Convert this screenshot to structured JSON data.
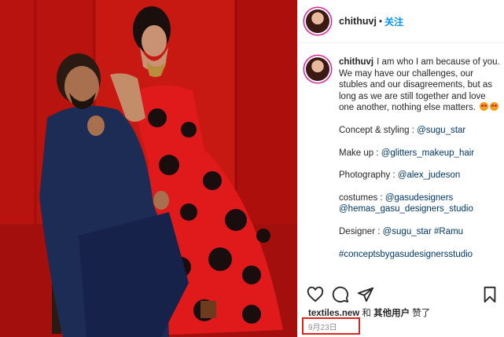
{
  "photo": {
    "alt_subject": "couple-photo",
    "accent_red": "#d41b16",
    "dress_red": "#e0191b",
    "suit_navy": "#1d2c55"
  },
  "header": {
    "username": "chithuvj",
    "separator": "•",
    "follow_label": "关注"
  },
  "caption": {
    "username": "chithuvj",
    "text": "I am who I am because of you. We may have our challenges, our stubles and our disagreements, but as long as we are still together and love one another, nothing else matters.",
    "concept_label": "Concept & styling : ",
    "concept_link": "@sugu_star",
    "makeup_label": "Make up : ",
    "makeup_link": "@glitters_makeup_hair",
    "photography_label": "Photography : ",
    "photography_link": "@alex_judeson",
    "costumes_label": "costumes : ",
    "costumes_link1": "@gasudesigners",
    "costumes_link2": "@hemas_gasu_designers_studio",
    "designer_label": "Designer : ",
    "designer_link1": "@sugu_star",
    "designer_link2": "#Ramu",
    "hashtag": "#conceptsbygasudesignersstudio"
  },
  "actions": {
    "like_icon": "heart-icon",
    "comment_icon": "comment-icon",
    "share_icon": "send-icon",
    "save_icon": "bookmark-icon"
  },
  "likes": {
    "user": "textiles.new",
    "and": " 和 ",
    "others": "其他用户",
    "liked": " 赞了"
  },
  "date": "9月23日",
  "colors": {
    "link": "#00376b",
    "follow": "#0095f6",
    "highlight_box": "#e0231b"
  }
}
